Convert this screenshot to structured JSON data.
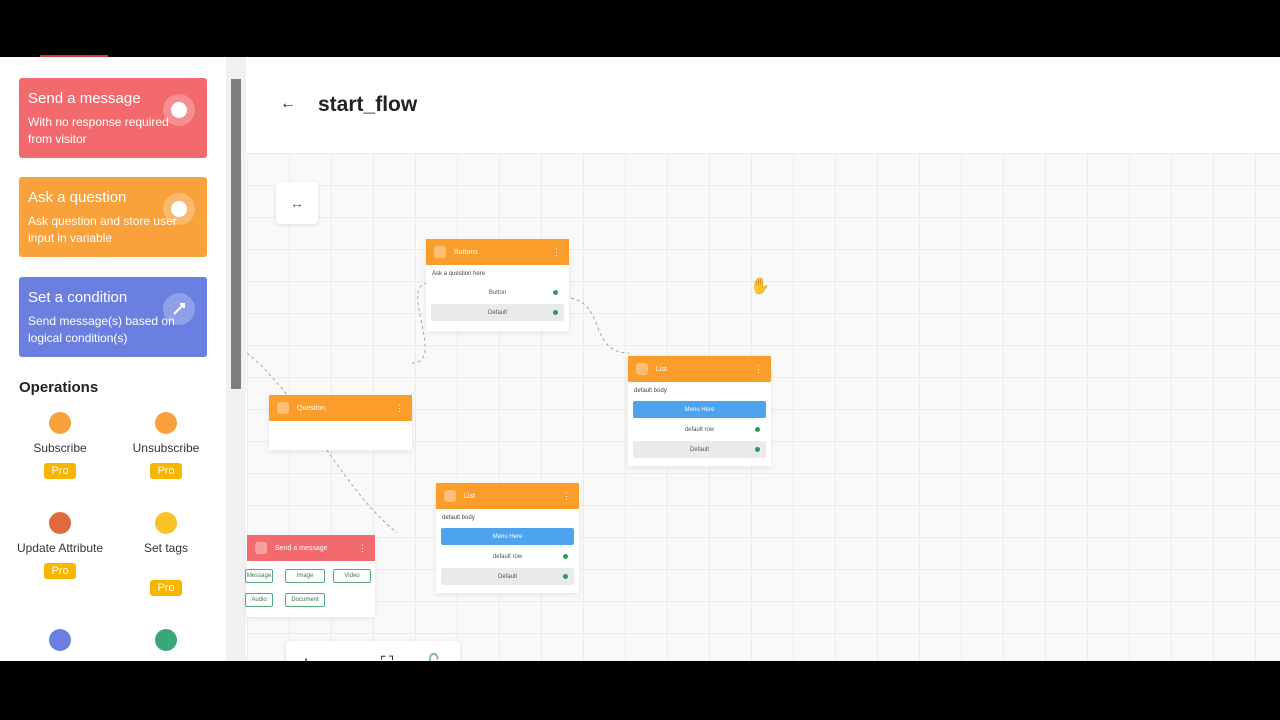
{
  "header": {
    "title": "start_flow",
    "back_icon": "arrow-left-icon"
  },
  "sidebar": {
    "blocks": [
      {
        "title": "Send a message",
        "desc": "With no response required from visitor",
        "color": "#f36a6e",
        "icon": "chat-icon"
      },
      {
        "title": "Ask a question",
        "desc": "Ask question and store user input in variable",
        "color": "#f9a23b",
        "icon": "question-icon"
      },
      {
        "title": "Set a condition",
        "desc": "Send message(s) based on logical condition(s)",
        "color": "#6a7fe0",
        "icon": "branch-icon"
      }
    ],
    "operations_title": "Operations",
    "operations": [
      {
        "label": "Subscribe",
        "pro": "Pro",
        "icon": "bell-icon",
        "color": "#f9a23b"
      },
      {
        "label": "Unsubscribe",
        "pro": "Pro",
        "icon": "bell-off-icon",
        "color": "#f9a23b"
      },
      {
        "label": "Update Attribute",
        "pro": "Pro",
        "icon": "tag-icon",
        "color": "#e06a3b"
      },
      {
        "label": "Set tags",
        "pro": "Pro",
        "icon": "bulb-icon",
        "color": "#f7c325"
      },
      {
        "label": "",
        "pro": "",
        "icon": "users-icon",
        "color": "#6a7fe0"
      },
      {
        "label": "",
        "pro": "",
        "icon": "user-add-icon",
        "color": "#3aa67a"
      }
    ]
  },
  "canvas": {
    "nodes": {
      "buttons": {
        "title": "Buttons",
        "body": "Ask a question here",
        "options": [
          "Button",
          "Default"
        ]
      },
      "question": {
        "title": "Question"
      },
      "list_right": {
        "title": "List",
        "body": "default body",
        "menu": "Menu Here",
        "options": [
          "default row",
          "Default"
        ]
      },
      "list_middle": {
        "title": "List",
        "body": "default body",
        "menu": "Menu Here",
        "options": [
          "default row",
          "Default"
        ]
      },
      "send_message": {
        "title": "Send a message",
        "chips": [
          "Message",
          "Image",
          "Video",
          "Audio",
          "Document"
        ]
      }
    },
    "controls": [
      "zoom-in-icon",
      "zoom-out-icon",
      "fit-view-icon",
      "lock-icon"
    ]
  }
}
